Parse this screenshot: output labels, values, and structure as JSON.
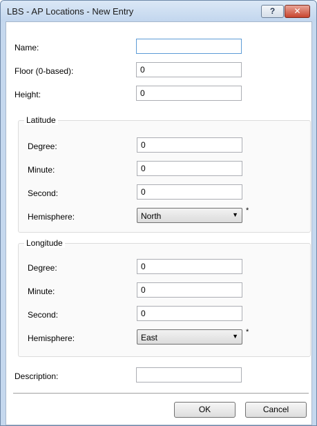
{
  "window": {
    "title": "LBS - AP Locations - New Entry",
    "help_label": "?",
    "close_label": "✕"
  },
  "fields": {
    "name": {
      "label": "Name:",
      "value": ""
    },
    "floor": {
      "label": "Floor (0-based):",
      "value": "0"
    },
    "height": {
      "label": "Height:",
      "value": "0"
    },
    "description": {
      "label": "Description:",
      "value": ""
    }
  },
  "latitude": {
    "legend": "Latitude",
    "degree": {
      "label": "Degree:",
      "value": "0"
    },
    "minute": {
      "label": "Minute:",
      "value": "0"
    },
    "second": {
      "label": "Second:",
      "value": "0"
    },
    "hemisphere": {
      "label": "Hemisphere:",
      "value": "North",
      "required_mark": "*"
    }
  },
  "longitude": {
    "legend": "Longitude",
    "degree": {
      "label": "Degree:",
      "value": "0"
    },
    "minute": {
      "label": "Minute:",
      "value": "0"
    },
    "second": {
      "label": "Second:",
      "value": "0"
    },
    "hemisphere": {
      "label": "Hemisphere:",
      "value": "East",
      "required_mark": "*"
    }
  },
  "buttons": {
    "ok": "OK",
    "cancel": "Cancel"
  }
}
